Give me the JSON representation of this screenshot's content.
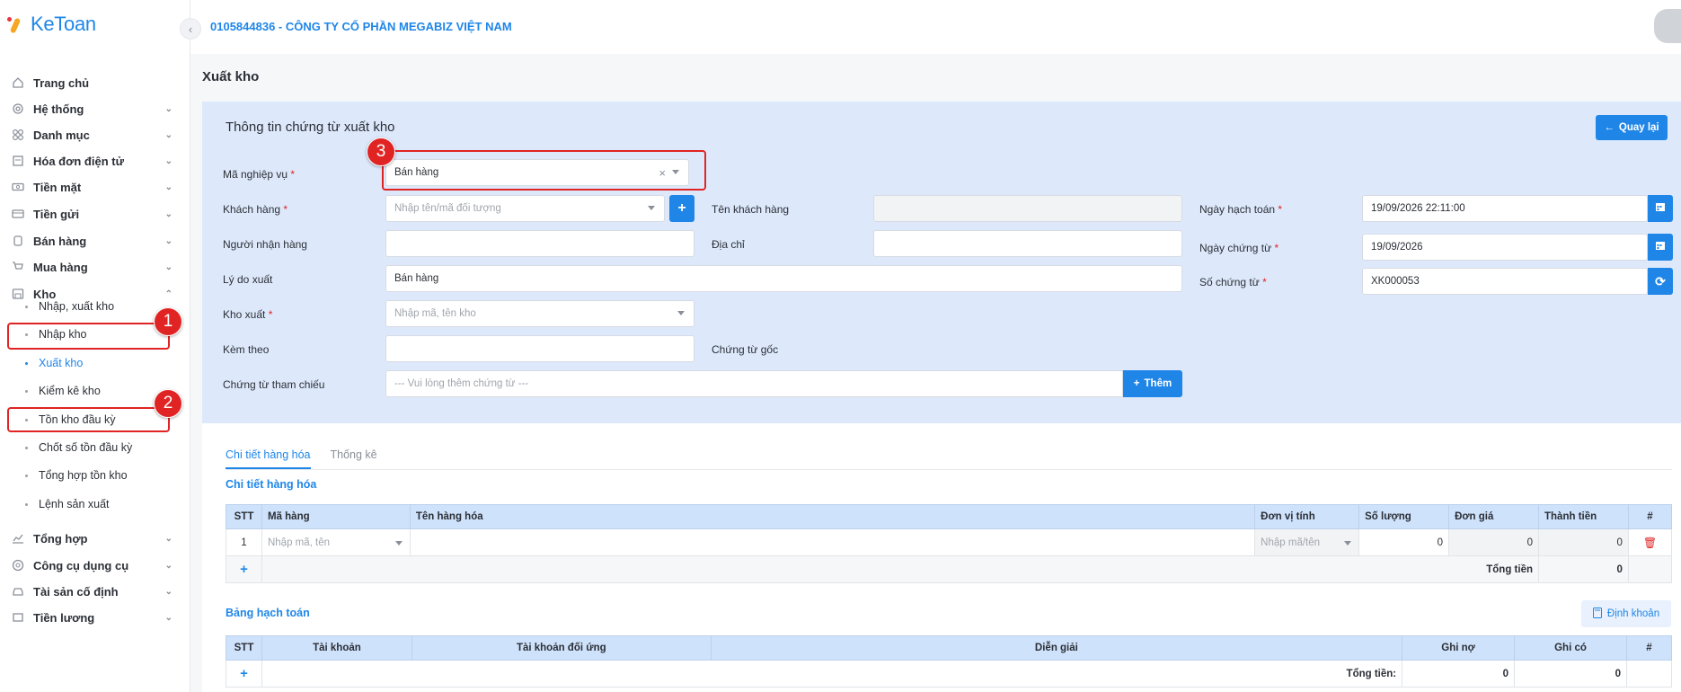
{
  "app": {
    "logo_text": "KeToan"
  },
  "header": {
    "company": "0105844836 - CÔNG TY CỔ PHẦN MEGABIZ VIỆT NAM"
  },
  "sidebar": {
    "items": [
      {
        "label": "Trang chủ",
        "icon": "home-icon"
      },
      {
        "label": "Hệ thống",
        "icon": "gear-icon"
      },
      {
        "label": "Danh mục",
        "icon": "grid-icon"
      },
      {
        "label": "Hóa đơn điện tử",
        "icon": "invoice-icon"
      },
      {
        "label": "Tiền mặt",
        "icon": "cash-icon"
      },
      {
        "label": "Tiền gửi",
        "icon": "bank-icon"
      },
      {
        "label": "Bán hàng",
        "icon": "sales-icon"
      },
      {
        "label": "Mua hàng",
        "icon": "cart-icon"
      },
      {
        "label": "Kho",
        "icon": "warehouse-icon"
      },
      {
        "label": "Tổng hợp",
        "icon": "chart-icon"
      },
      {
        "label": "Công cụ dụng cụ",
        "icon": "tools-icon"
      },
      {
        "label": "Tài sản cố định",
        "icon": "car-icon"
      },
      {
        "label": "Tiền lương",
        "icon": "salary-icon"
      }
    ],
    "kho_sub": [
      "Nhập, xuất kho",
      "Nhập kho",
      "Xuất kho",
      "Kiểm kê kho",
      "Tồn kho đầu kỳ",
      "Chốt số tồn đầu kỳ",
      "Tổng hợp tồn kho",
      "Lệnh sản xuất"
    ],
    "active_sub": "Xuất kho"
  },
  "annotations": [
    "1",
    "2",
    "3"
  ],
  "page": {
    "title": "Xuất kho"
  },
  "form": {
    "title": "Thông tin chứng từ xuất kho",
    "back_label": "Quay lại",
    "ma_nghiep_vu": {
      "label": "Mã nghiệp vụ",
      "value": "Bán hàng"
    },
    "khach_hang": {
      "label": "Khách hàng",
      "placeholder": "Nhập tên/mã đối tượng"
    },
    "ten_khach_hang": {
      "label": "Tên khách hàng",
      "value": ""
    },
    "nguoi_nhan_hang": {
      "label": "Người nhận hàng",
      "value": ""
    },
    "dia_chi": {
      "label": "Địa chỉ",
      "value": ""
    },
    "ly_do_xuat": {
      "label": "Lý do xuất",
      "value": "Bán hàng"
    },
    "kho_xuat": {
      "label": "Kho xuất",
      "placeholder": "Nhập mã, tên kho"
    },
    "kem_theo": {
      "label": "Kèm theo",
      "value": ""
    },
    "chung_tu_goc": {
      "label": "Chứng từ gốc"
    },
    "chung_tu_tham_chieu": {
      "label": "Chứng từ tham chiếu",
      "placeholder": "--- Vui lòng thêm chứng từ ---",
      "add_label": "Thêm"
    },
    "ngay_hach_toan": {
      "label": "Ngày hạch toán",
      "value": "19/09/2026 22:11:00"
    },
    "ngay_chung_tu": {
      "label": "Ngày chứng từ",
      "value": "19/09/2026"
    },
    "so_chung_tu": {
      "label": "Số chứng từ",
      "value": "XK000053"
    }
  },
  "detail": {
    "tabs": [
      "Chi tiết hàng hóa",
      "Thống kê"
    ],
    "goods_title": "Chi tiết hàng hóa",
    "goods_headers": [
      "STT",
      "Mã hàng",
      "Tên hàng hóa",
      "Đơn vị tính",
      "Số lượng",
      "Đơn giá",
      "Thành tiền",
      "#"
    ],
    "goods_row": {
      "stt": "1",
      "ma_hang_ph": "Nhập mã, tên",
      "dvt_ph": "Nhập mã/tên",
      "so_luong": "0",
      "don_gia": "0",
      "thanh_tien": "0"
    },
    "goods_total_label": "Tổng tiền",
    "goods_total": "0",
    "acct_title": "Bảng hạch toán",
    "dinh_khoan_label": "Định khoản",
    "acct_headers": [
      "STT",
      "Tài khoản",
      "Tài khoản đối ứng",
      "Diễn giải",
      "Ghi nợ",
      "Ghi có",
      "#"
    ],
    "acct_total_label": "Tổng tiền:",
    "acct_no": "0",
    "acct_co": "0"
  }
}
